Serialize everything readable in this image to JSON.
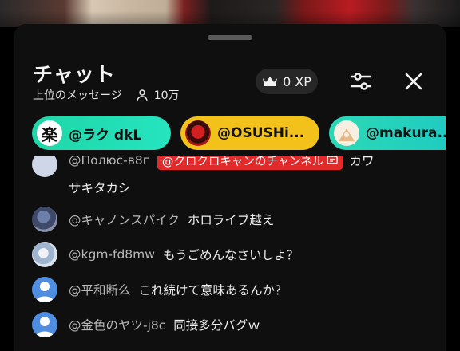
{
  "header": {
    "title": "チャット",
    "subtitle": "上位のメッセージ",
    "viewers": "10万",
    "xp_label": "0 XP"
  },
  "pinned": [
    {
      "name": "@ラク dkL",
      "avatar_char": "楽",
      "color": "#1fd6a8"
    },
    {
      "name": "@OSUSHi...",
      "color": "#f2c21a"
    },
    {
      "name": "@makura...",
      "color": "#2bd9b6"
    }
  ],
  "messages": [
    {
      "author": "@Полюс-в8г",
      "badge": "@クロクロキャンのチャンネル",
      "text": "カワ",
      "continuation": "サキタカシ"
    },
    {
      "author": "@キャノンスパイク",
      "text": "ホロライブ越え"
    },
    {
      "author": "@kgm-fd8mw",
      "text": "もうごめんなさいしよ？"
    },
    {
      "author": "@平和断么",
      "text": "これ続けて意味あるんか？"
    },
    {
      "author": "@金色のヤツ-j8c",
      "text": "同接多分バグｗ"
    }
  ],
  "icons": {
    "xp": "crown-icon",
    "viewers": "person-icon",
    "filter": "sliders-icon",
    "close": "close-icon"
  },
  "colors": {
    "background": "#0f0f0f",
    "badge": "#e22a2a",
    "chip_green": "#1fd6a8",
    "chip_yellow": "#f2c21a",
    "avatar_blue": "#4f8de0"
  }
}
